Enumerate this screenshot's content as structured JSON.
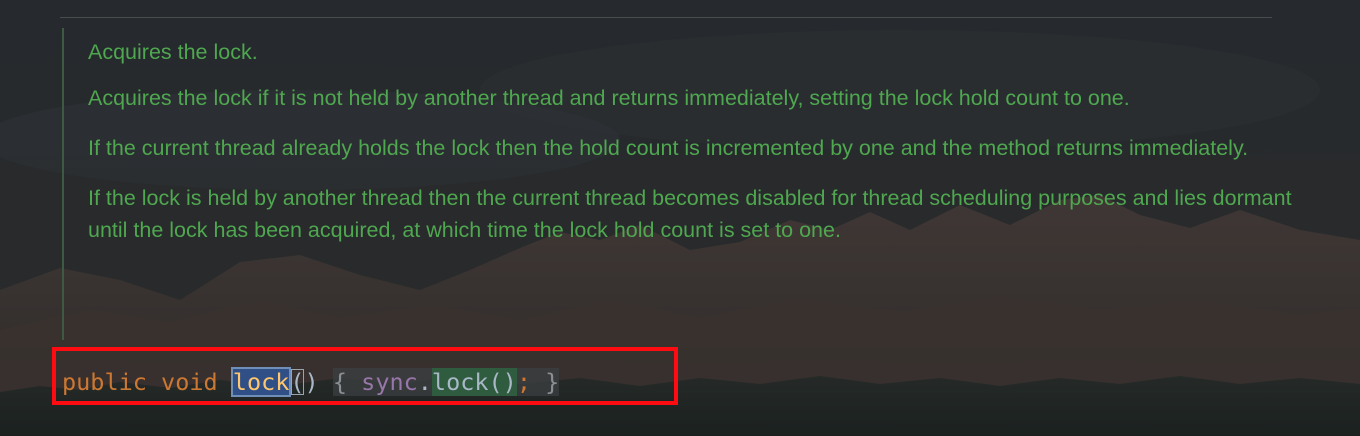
{
  "doc": {
    "paragraphs": [
      "Acquires the lock.",
      "Acquires the lock if it is not held by another thread and returns immediately, setting the lock hold count to one.",
      "If the current thread already holds the lock then the hold count is incremented by one and the method returns immediately.",
      "If the lock is held by another thread then the current thread becomes disabled for thread scheduling purposes and lies dormant until the lock has been acquired, at which time the lock hold count is set to one."
    ]
  },
  "code": {
    "kw_public": "public",
    "kw_void": "void",
    "method_name": "lock",
    "paren_open": "(",
    "paren_close": ")",
    "brace_open": "{",
    "field": "sync",
    "dot": ".",
    "call_name": "lock",
    "call_parens": "()",
    "semicolon": ";",
    "brace_close": "}"
  },
  "colors": {
    "doc_text": "#4fa74f",
    "keyword": "#cc7832",
    "method_declaration": "#ffc66d",
    "field": "#9876aa",
    "highlight_border": "#ff0b12"
  }
}
